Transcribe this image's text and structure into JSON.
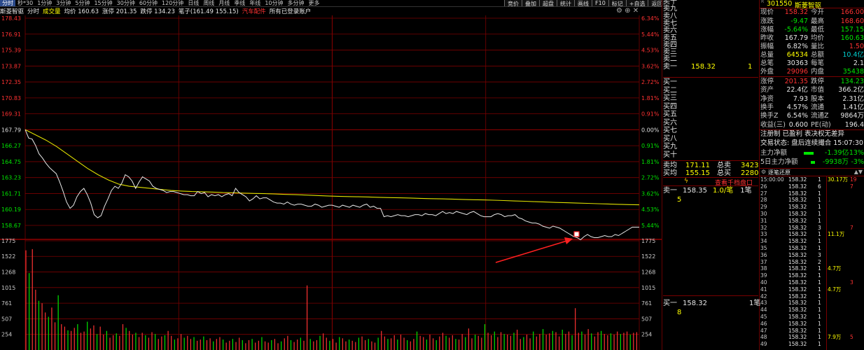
{
  "toolbar": {
    "badge": "分时",
    "items": [
      "分时",
      "秒*30",
      "1分钟",
      "3分钟",
      "5分钟",
      "15分钟",
      "30分钟",
      "60分钟",
      "120分钟",
      "日线",
      "周线",
      "月线",
      "季线",
      "年线",
      "10分钟",
      "多分钟",
      "更多"
    ],
    "right": [
      "竞价",
      "叠加",
      "超盘",
      "统计",
      "画线",
      "F10",
      "标记",
      "+自选",
      "返回"
    ]
  },
  "info": {
    "name": "斯菱智驱",
    "mode": "分时",
    "volume_label": "成交量",
    "avg": "均价 160.63",
    "limit_up": "涨停 201.35",
    "limit_down": "跌停 134.23",
    "pen": "笔子(161.49 155.15)",
    "concept": "汽车配件",
    "account": "所有已登录账户"
  },
  "chart_data": {
    "type": "line",
    "prev_close": 167.79,
    "y_ticks": [
      "178.43",
      "176.91",
      "175.39",
      "173.87",
      "172.35",
      "170.83",
      "169.31",
      "167.79",
      "166.27",
      "164.75",
      "163.23",
      "161.71",
      "160.19",
      "158.67"
    ],
    "pct_ticks": [
      "6.34%",
      "5.44%",
      "4.53%",
      "3.62%",
      "2.72%",
      "1.81%",
      "0.91%",
      "0.00%",
      "0.91%",
      "1.81%",
      "2.72%",
      "3.62%",
      "4.53%",
      "5.44%"
    ],
    "vol_ticks": [
      "1775",
      "1522",
      "1268",
      "1015",
      "761",
      "507",
      "254"
    ],
    "price": [
      167.8,
      167.0,
      166.9,
      166.3,
      165.5,
      165.1,
      164.6,
      164.2,
      163.9,
      163.6,
      162.8,
      161.9,
      160.9,
      160.3,
      160.6,
      161.4,
      161.9,
      162.2,
      161.6,
      160.8,
      159.7,
      159.4,
      159.6,
      160.5,
      161.2,
      162.0,
      162.4,
      162.2,
      162.7,
      163.5,
      163.3,
      162.9,
      162.2,
      162.8,
      163.3,
      163.1,
      162.9,
      162.4,
      162.2,
      162.1,
      162.0,
      161.8,
      161.9,
      161.9,
      161.8,
      161.7,
      161.6,
      161.6,
      161.5,
      161.5,
      161.9,
      161.7,
      161.8,
      161.4,
      161.6,
      161.5,
      161.6,
      161.4,
      161.6,
      161.7,
      161.5,
      162.2,
      161.8,
      161.6,
      161.4,
      161.0,
      161.2,
      161.5,
      161.2,
      161.3,
      161.3,
      161.1,
      160.9,
      160.8,
      160.8,
      160.7,
      160.9,
      160.7,
      160.6,
      160.7,
      160.7,
      160.6,
      160.5,
      160.5,
      160.7,
      160.6,
      160.4,
      160.5,
      160.6,
      160.6,
      160.5,
      160.4,
      160.6,
      160.5,
      160.4,
      160.6,
      160.5,
      160.4,
      160.6,
      160.7,
      160.4,
      160.5,
      160.3,
      160.3,
      159.5,
      159.6,
      159.5,
      159.6,
      159.7,
      159.6,
      159.6,
      159.5,
      159.6,
      159.7,
      159.7,
      159.6,
      159.8,
      159.7,
      159.7,
      159.6,
      159.8,
      160.0,
      159.8,
      159.9,
      159.8,
      160.0,
      159.9,
      159.8,
      159.7,
      159.9,
      160.0,
      159.8,
      159.6,
      159.5,
      159.5,
      159.5,
      159.7,
      159.8,
      159.7,
      159.5,
      159.6,
      159.6,
      159.7,
      159.4,
      159.3,
      159.1,
      159.0,
      158.9,
      158.9,
      158.8,
      158.6,
      158.5,
      158.4,
      158.6,
      158.5,
      158.4,
      158.2,
      158.0,
      157.8,
      157.6,
      157.5,
      157.3,
      157.6,
      157.8,
      157.6,
      157.5,
      157.5,
      157.6,
      157.7,
      157.6,
      157.6,
      157.8,
      157.7,
      157.9,
      158.1,
      158.3,
      158.5,
      158.5,
      158.5
    ],
    "avg": [
      167.8,
      167.3,
      166.8,
      166.2,
      165.5,
      164.8,
      164.1,
      163.5,
      163.0,
      162.6,
      162.4,
      162.3,
      162.2,
      162.1,
      162.0,
      161.95,
      161.9,
      161.88,
      161.85,
      161.8,
      161.78,
      161.75,
      161.72,
      161.7,
      161.67,
      161.63,
      161.6,
      161.56,
      161.52,
      161.48,
      161.45,
      161.42,
      161.4,
      161.38,
      161.35,
      161.32,
      161.3,
      161.28,
      161.25,
      161.22,
      161.2,
      161.18,
      161.15,
      161.12,
      161.1,
      161.07,
      161.04,
      161.0,
      160.97,
      160.93,
      160.9,
      160.86,
      160.83,
      160.8,
      160.77,
      160.74,
      160.71,
      160.68,
      160.65,
      160.63
    ],
    "volume": [
      1620,
      1250,
      1640,
      980,
      800,
      760,
      610,
      540,
      690,
      450,
      890,
      420,
      380,
      320,
      310,
      360,
      420,
      280,
      300,
      460,
      350,
      400,
      260,
      380,
      250,
      310,
      200,
      240,
      270,
      230,
      420,
      360,
      310,
      250,
      280,
      210,
      280,
      240,
      200,
      290,
      260,
      180,
      220,
      240,
      310,
      230,
      170,
      190,
      260,
      200,
      230,
      180,
      210,
      150,
      170,
      220,
      160,
      190,
      140,
      180,
      210,
      170,
      120,
      150,
      180,
      130,
      200,
      160,
      110,
      160,
      180,
      120,
      150,
      210,
      140,
      120,
      160,
      180,
      110,
      140,
      190,
      230,
      160,
      130,
      170,
      200,
      150,
      1050,
      180,
      140,
      160,
      230,
      270,
      200,
      150,
      180,
      120,
      210,
      190,
      140,
      170,
      150,
      130,
      200,
      220,
      160,
      180,
      140,
      120,
      200,
      310,
      220,
      180,
      190,
      240,
      170,
      250,
      200,
      160,
      140,
      180,
      300,
      230,
      210,
      170,
      250,
      190,
      160,
      220,
      280,
      230,
      200,
      240,
      180,
      170,
      260,
      210,
      350,
      190,
      250,
      230,
      200,
      420,
      280,
      240,
      300,
      210,
      290,
      260,
      250,
      230,
      280,
      330,
      180,
      210,
      250,
      190,
      300,
      220,
      260,
      340,
      250,
      270,
      310,
      290,
      220,
      330,
      260,
      300,
      240,
      680,
      280,
      300,
      250,
      340,
      270,
      220,
      290,
      310,
      260,
      240,
      270,
      250,
      300,
      260,
      280,
      300,
      250,
      280,
      290
    ]
  },
  "link": "查看千档盘口",
  "order_book": {
    "sell_labels": [
      "卖十",
      "卖九",
      "卖八",
      "卖七",
      "卖六",
      "卖五",
      "卖四",
      "卖三",
      "卖二",
      "卖一"
    ],
    "sell1_price": "158.32",
    "sell1_vol": "1",
    "buy_labels": [
      "买一",
      "买二",
      "买三",
      "买四",
      "买五",
      "买六",
      "买七",
      "买八",
      "买九",
      "买十"
    ],
    "avg_sell_label": "卖均",
    "avg_sell": "171.11",
    "total_sell_label": "总卖",
    "total_sell": "3423",
    "avg_buy_label": "买均",
    "avg_buy": "155.15",
    "total_buy_label": "总买",
    "total_buy": "2280",
    "queue_sell_label": "卖一",
    "queue_sell_price": "158.35",
    "queue_sell_count": "1.0/笔",
    "queue_sell_n": "1笔",
    "queue_sell_first": "5",
    "queue_buy_label": "买一",
    "queue_buy_price": "158.32",
    "queue_buy_n": "1笔",
    "queue_buy_first": "8"
  },
  "stock": {
    "code": "301550",
    "name": "斯菱智驱",
    "rows": [
      {
        "l1": "现价",
        "v1": "158.32",
        "c1": "red",
        "l2": "今开",
        "v2": "166.00",
        "c2": "red"
      },
      {
        "l1": "涨跌",
        "v1": "-9.47",
        "c1": "green",
        "l2": "最高",
        "v2": "168.60",
        "c2": "red"
      },
      {
        "l1": "涨幅",
        "v1": "-5.64%",
        "c1": "green",
        "l2": "最低",
        "v2": "157.15",
        "c2": "green"
      },
      {
        "l1": "昨收",
        "v1": "167.79",
        "c1": "white",
        "l2": "均价",
        "v2": "160.63",
        "c2": "green"
      },
      {
        "l1": "振幅",
        "v1": "6.82%",
        "c1": "white",
        "l2": "量比",
        "v2": "1.50",
        "c2": "red"
      },
      {
        "l1": "总量",
        "v1": "64534",
        "c1": "yellow",
        "l2": "总额",
        "v2": "10.4亿",
        "c2": "cyan"
      },
      {
        "l1": "总笔",
        "v1": "30363",
        "c1": "white",
        "l2": "每笔",
        "v2": "2.1",
        "c2": "white"
      },
      {
        "l1": "外盘",
        "v1": "29096",
        "c1": "red",
        "l2": "内盘",
        "v2": "35438",
        "c2": "green"
      },
      {
        "l1": "涨停",
        "v1": "201.35",
        "c1": "red",
        "l2": "跌停",
        "v2": "134.23",
        "c2": "green"
      },
      {
        "l1": "资产",
        "v1": "22.4亿",
        "c1": "white",
        "l2": "市值",
        "v2": "366.2亿",
        "c2": "white"
      },
      {
        "l1": "净资",
        "v1": "7.93",
        "c1": "white",
        "l2": "股本",
        "v2": "2.31亿",
        "c2": "white"
      },
      {
        "l1": "换手",
        "v1": "4.57%",
        "c1": "white",
        "l2": "流通",
        "v2": "1.41亿",
        "c2": "white"
      },
      {
        "l1": "换手Z",
        "v1": "6.54%",
        "c1": "white",
        "l2": "流通Z",
        "v2": "9864万",
        "c2": "white"
      },
      {
        "l1": "收益(三)",
        "v1": "0.600",
        "c1": "white",
        "l2": "PE(动)",
        "v2": "196.4",
        "c2": "white"
      }
    ],
    "reg_line": "注册制 已盈利 表决权无差异",
    "trade_status": "交易状态: 盘后连续撮合 15:07:30",
    "main_net_label": "主力净额",
    "main_net_value": "-1.39亿",
    "main_net_pct": "-13%",
    "main5_label": "5日主力净额",
    "main5_value": "-9938万",
    "main5_pct": "-3%",
    "ticks_header": "逐笔还原",
    "ticks": [
      {
        "t": "15:00:00",
        "p": "158.32",
        "n": "1",
        "v": "19",
        "v2": "30.17万"
      },
      {
        "t": "26",
        "p": "158.32",
        "n": "6",
        "v": "7",
        "v2": ""
      },
      {
        "t": "27",
        "p": "158.32",
        "n": "1",
        "v": "",
        "v2": ""
      },
      {
        "t": "28",
        "p": "158.32",
        "n": "1",
        "v": "",
        "v2": ""
      },
      {
        "t": "29",
        "p": "158.32",
        "n": "1",
        "v": "",
        "v2": ""
      },
      {
        "t": "30",
        "p": "158.32",
        "n": "1",
        "v": "",
        "v2": ""
      },
      {
        "t": "31",
        "p": "158.32",
        "n": "1",
        "v": "",
        "v2": ""
      },
      {
        "t": "32",
        "p": "158.32",
        "n": "3",
        "v": "7",
        "v2": ""
      },
      {
        "t": "33",
        "p": "158.32",
        "n": "1",
        "v": "",
        "v2": "11.1万"
      },
      {
        "t": "34",
        "p": "158.32",
        "n": "1",
        "v": "",
        "v2": ""
      },
      {
        "t": "35",
        "p": "158.32",
        "n": "1",
        "v": "",
        "v2": ""
      },
      {
        "t": "36",
        "p": "158.32",
        "n": "3",
        "v": "",
        "v2": ""
      },
      {
        "t": "37",
        "p": "158.32",
        "n": "2",
        "v": "",
        "v2": ""
      },
      {
        "t": "38",
        "p": "158.32",
        "n": "1",
        "v": "",
        "v2": "4.7万"
      },
      {
        "t": "39",
        "p": "158.32",
        "n": "1",
        "v": "",
        "v2": ""
      },
      {
        "t": "40",
        "p": "158.32",
        "n": "1",
        "v": "3",
        "v2": ""
      },
      {
        "t": "41",
        "p": "158.32",
        "n": "1",
        "v": "",
        "v2": "4.7万"
      },
      {
        "t": "42",
        "p": "158.32",
        "n": "1",
        "v": "",
        "v2": ""
      },
      {
        "t": "43",
        "p": "158.32",
        "n": "1",
        "v": "",
        "v2": ""
      },
      {
        "t": "44",
        "p": "158.32",
        "n": "1",
        "v": "",
        "v2": ""
      },
      {
        "t": "45",
        "p": "158.32",
        "n": "1",
        "v": "",
        "v2": ""
      },
      {
        "t": "46",
        "p": "158.32",
        "n": "1",
        "v": "",
        "v2": ""
      },
      {
        "t": "47",
        "p": "158.32",
        "n": "1",
        "v": "",
        "v2": ""
      },
      {
        "t": "48",
        "p": "158.32",
        "n": "1",
        "v": "5",
        "v2": "7.9万"
      },
      {
        "t": "49",
        "p": "158.32",
        "n": "1",
        "v": "",
        "v2": ""
      }
    ]
  },
  "colors": {
    "grid": "#7a0000",
    "price": "#e8e8e8",
    "avg": "#e0e000",
    "up": "#ff3232",
    "down": "#00e600",
    "annot": "#ff2020"
  }
}
